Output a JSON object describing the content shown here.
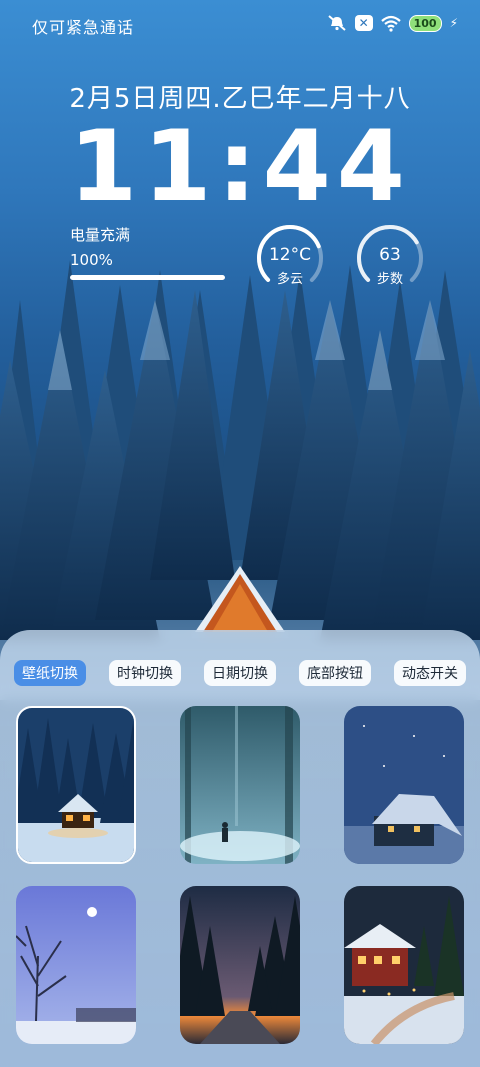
{
  "status_bar": {
    "carrier_text": "仅可紧急通话",
    "battery_level": "100",
    "icons": [
      "mute-icon",
      "close-box-icon",
      "wifi-icon",
      "battery-icon",
      "charging-bolt-icon"
    ]
  },
  "lockscreen": {
    "date": "2月5日周四.乙巳年二月十八",
    "time": "11:44",
    "charge_label": "电量充满",
    "charge_percent_text": "100%",
    "charge_level": 1.0,
    "weather_temp": "12°C",
    "weather_desc": "多云",
    "weather_level": 0.75,
    "steps_value": "63",
    "steps_label": "步数",
    "steps_level": 0.72
  },
  "panel": {
    "tabs": [
      {
        "label": "壁纸切换",
        "active": true
      },
      {
        "label": "时钟切换",
        "active": false
      },
      {
        "label": "日期切换",
        "active": false
      },
      {
        "label": "底部按钮",
        "active": false
      },
      {
        "label": "动态开关",
        "active": false
      }
    ],
    "wallpapers": [
      {
        "name": "snowy-cabin-night",
        "selected": true
      },
      {
        "name": "foggy-forest-walker",
        "selected": false
      },
      {
        "name": "snow-cabin-blue",
        "selected": false
      },
      {
        "name": "moon-bare-tree",
        "selected": false
      },
      {
        "name": "forest-road-dusk",
        "selected": false
      },
      {
        "name": "christmas-cabin",
        "selected": false
      }
    ]
  },
  "colors": {
    "accent": "#4a8ee6",
    "panel_bg": "#c4d8ee"
  }
}
